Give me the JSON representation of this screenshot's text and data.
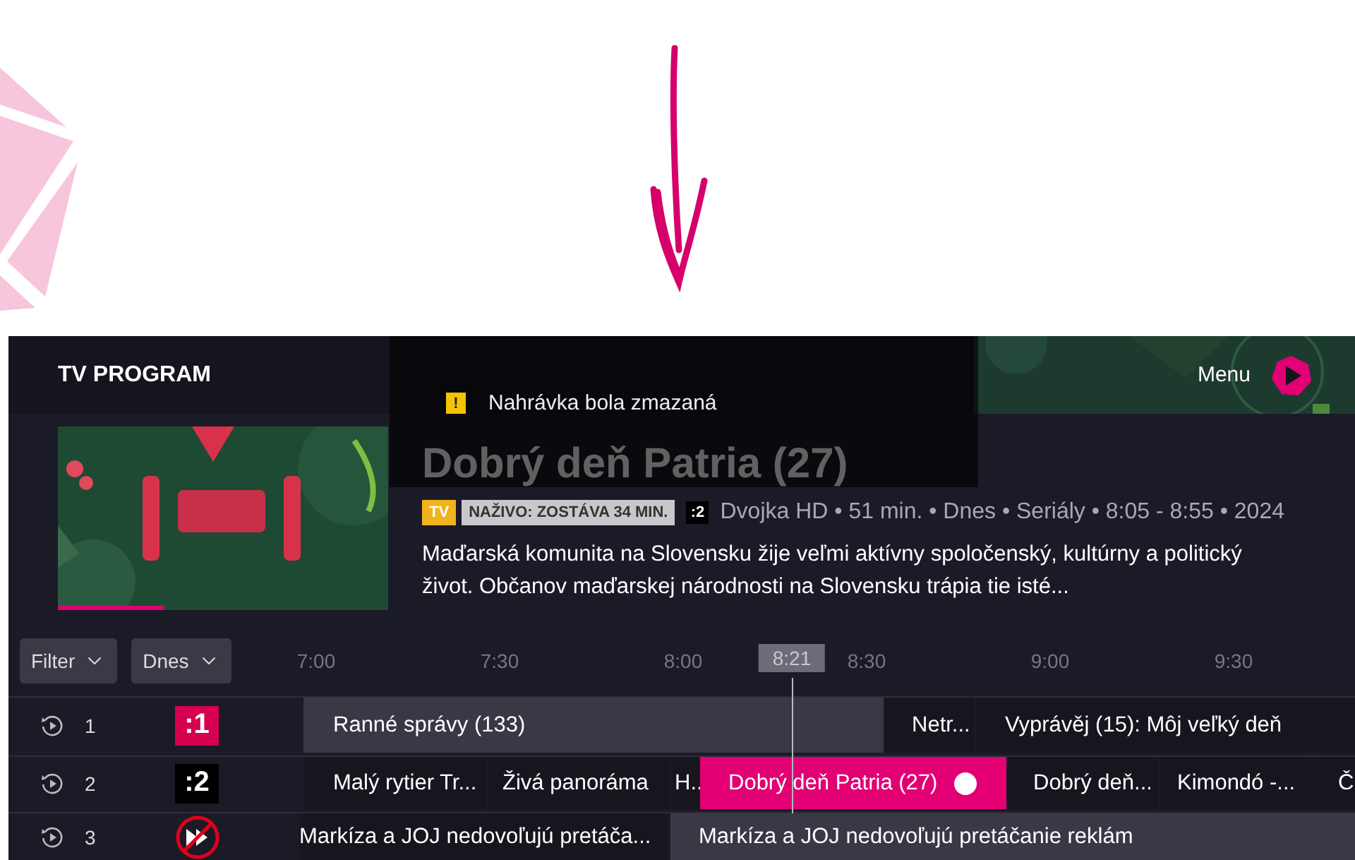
{
  "screen_title": "TV PROGRAM",
  "menu": {
    "label": "Menu"
  },
  "toast": {
    "icon_text": "!",
    "message": "Nahrávka bola zmazaná"
  },
  "program": {
    "title": "Dobrý deň Patria (27)",
    "progress": {
      "level": 0.32
    },
    "badges": [
      {
        "kind": "type",
        "text": "TV"
      },
      {
        "kind": "live",
        "text": "NAŽIVO: ZOSTÁVA 34 MIN."
      }
    ],
    "channel_logo": ":2",
    "details": "Dvojka HD • 51 min. • Dnes • Seriály • 8:05 - 8:55 • 2024",
    "description": "Maďarská komunita na Slovensku žije veľmi aktívny spoločenský, kultúrny a politický život. Občanov maďarskej národnosti na Slovensku trápia tie isté..."
  },
  "filters": [
    {
      "label": "Filter"
    },
    {
      "label": "Dnes"
    }
  ],
  "timeline": {
    "times": [
      "7:00",
      "7:30",
      "8:00",
      "8:30",
      "9:00",
      "9:30"
    ],
    "now": "8:21"
  },
  "channels": [
    {
      "number": "1",
      "logo": {
        "kind": "text",
        "text": ":1",
        "color": "#d6004f"
      },
      "programs": [
        {
          "title": "Ranné správy (133)",
          "kind": "past",
          "selected": false
        },
        {
          "title": "Netr...",
          "kind": "plain",
          "selected": false
        },
        {
          "title": "Vyprávěj (15): Môj veľký deň",
          "kind": "plain",
          "selected": false
        }
      ]
    },
    {
      "number": "2",
      "logo": {
        "kind": "text",
        "text": ":2",
        "color": "#000000"
      },
      "programs": [
        {
          "title": "Malý rytier Tr...",
          "kind": "plain",
          "selected": false
        },
        {
          "title": "Živá panoráma",
          "kind": "plain",
          "selected": false
        },
        {
          "title": "H..",
          "kind": "plain",
          "selected": false
        },
        {
          "title": "Dobrý deň Patria (27)",
          "kind": "plain",
          "selected": true
        },
        {
          "title": "Dobrý deň...",
          "kind": "plain",
          "selected": false
        },
        {
          "title": "Kimondó -...",
          "kind": "plain",
          "selected": false
        },
        {
          "title": "Č",
          "kind": "plain",
          "selected": false
        }
      ]
    },
    {
      "number": "3",
      "logo": {
        "kind": "no-skip"
      },
      "programs": [
        {
          "title": "Markíza a JOJ nedovoľujú pretáča...",
          "kind": "plain",
          "selected": false
        },
        {
          "title": "Markíza a JOJ nedovoľujú pretáčanie reklám",
          "kind": "past",
          "selected": false
        }
      ]
    }
  ]
}
